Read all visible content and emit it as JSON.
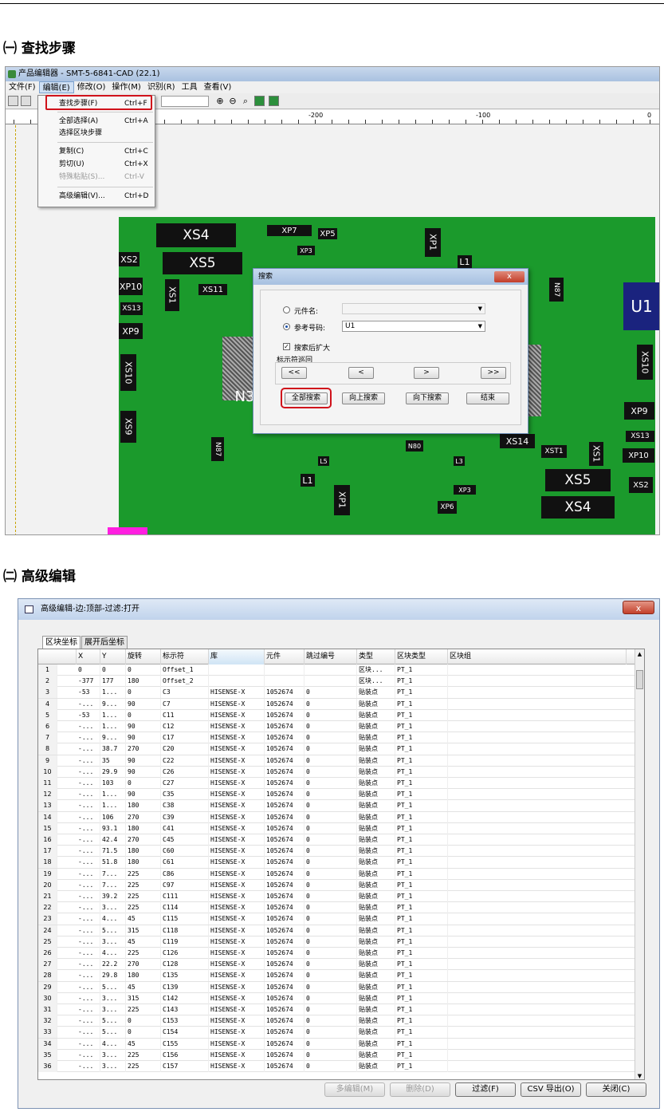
{
  "headings": {
    "h1": "㈠ 查找步骤",
    "h2": "㈡ 高级编辑"
  },
  "app1": {
    "title": "产品编辑器 - SMT-5-6841-CAD (22.1)",
    "menu": [
      "文件(F)",
      "编辑(E)",
      "修改(O)",
      "操作(M)",
      "识别(R)",
      "工具",
      "查看(V)"
    ],
    "ruler_labels": [
      "-200",
      "-100",
      "0"
    ],
    "dropdown": [
      {
        "label": "查找步骤(F)",
        "shortcut": "Ctrl+F"
      },
      {
        "label": "全部选择(A)",
        "shortcut": "Ctrl+A"
      },
      {
        "label": "选择区块步骤",
        "shortcut": ""
      },
      {
        "label": "复制(C)",
        "shortcut": "Ctrl+C"
      },
      {
        "label": "剪切(U)",
        "shortcut": "Ctrl+X"
      },
      {
        "label": "特殊粘贴(S)...",
        "shortcut": "Ctrl-V"
      },
      {
        "label": "高级编辑(V)...",
        "shortcut": "Ctrl+D"
      }
    ],
    "pcb_labels": {
      "xs4": "XS4",
      "xs5": "XS5",
      "xs2": "XS2",
      "xp10": "XP10",
      "xs13": "XS13",
      "xp9": "XP9",
      "xs10": "XS10",
      "xs9": "XS9",
      "xs1": "XS1",
      "xs11": "XS11",
      "xp7": "XP7",
      "xp5": "XP5",
      "xp3": "XP3",
      "xp1": "XP1",
      "l1": "L1",
      "n3": "N3",
      "u1": "U1",
      "xs14": "XS14",
      "xst1": "XST1",
      "xp6": "XP6",
      "xs2r": "XS2",
      "xp10r": "XP10",
      "xs13r": "XS13",
      "n80": "N80",
      "l5": "L5",
      "l3": "L3",
      "n87": "N87"
    },
    "dialog": {
      "title": "搜索",
      "close": "x",
      "opt_component": "元件名:",
      "opt_refdes": "参考号码:",
      "refdes_value": "U1",
      "expand_label": "搜索后扩大",
      "group_label": "标示符巡回",
      "nav": [
        "<<",
        "<",
        ">",
        ">>"
      ],
      "buttons": [
        "全部搜索",
        "向上搜索",
        "向下搜索",
        "结束"
      ]
    }
  },
  "app2": {
    "title": "高级编辑-边:顶部-过滤:打开",
    "close": "x",
    "tabs": [
      "区块坐标",
      "展开后坐标"
    ],
    "columns": [
      "",
      "X",
      "Y",
      "旋转",
      "标示符",
      "库",
      "元件",
      "跳过编号",
      "类型",
      "区块类型",
      "区块组"
    ],
    "rows": [
      [
        "1",
        "0",
        "0",
        "0",
        "Offset_1",
        "",
        "",
        "",
        "区块...",
        "PT_1"
      ],
      [
        "2",
        "-377",
        "177",
        "180",
        "Offset_2",
        "",
        "",
        "",
        "区块...",
        "PT_1"
      ],
      [
        "3",
        "-53",
        "1...",
        "0",
        "C3",
        "HISENSE-X",
        "1052674",
        "0",
        "贴装点",
        "PT_1"
      ],
      [
        "4",
        "-...",
        "9...",
        "90",
        "C7",
        "HISENSE-X",
        "1052674",
        "0",
        "贴装点",
        "PT_1"
      ],
      [
        "5",
        "-53",
        "1...",
        "0",
        "C11",
        "HISENSE-X",
        "1052674",
        "0",
        "贴装点",
        "PT_1"
      ],
      [
        "6",
        "-...",
        "1...",
        "90",
        "C12",
        "HISENSE-X",
        "1052674",
        "0",
        "贴装点",
        "PT_1"
      ],
      [
        "7",
        "-...",
        "9...",
        "90",
        "C17",
        "HISENSE-X",
        "1052674",
        "0",
        "贴装点",
        "PT_1"
      ],
      [
        "8",
        "-...",
        "38.7",
        "270",
        "C20",
        "HISENSE-X",
        "1052674",
        "0",
        "贴装点",
        "PT_1"
      ],
      [
        "9",
        "-...",
        "35",
        "90",
        "C22",
        "HISENSE-X",
        "1052674",
        "0",
        "贴装点",
        "PT_1"
      ],
      [
        "10",
        "-...",
        "29.9",
        "90",
        "C26",
        "HISENSE-X",
        "1052674",
        "0",
        "贴装点",
        "PT_1"
      ],
      [
        "11",
        "-...",
        "103",
        "0",
        "C27",
        "HISENSE-X",
        "1052674",
        "0",
        "贴装点",
        "PT_1"
      ],
      [
        "12",
        "-...",
        "1...",
        "90",
        "C35",
        "HISENSE-X",
        "1052674",
        "0",
        "贴装点",
        "PT_1"
      ],
      [
        "13",
        "-...",
        "1...",
        "180",
        "C38",
        "HISENSE-X",
        "1052674",
        "0",
        "贴装点",
        "PT_1"
      ],
      [
        "14",
        "-...",
        "106",
        "270",
        "C39",
        "HISENSE-X",
        "1052674",
        "0",
        "贴装点",
        "PT_1"
      ],
      [
        "15",
        "-...",
        "93.1",
        "180",
        "C41",
        "HISENSE-X",
        "1052674",
        "0",
        "贴装点",
        "PT_1"
      ],
      [
        "16",
        "-...",
        "42.4",
        "270",
        "C45",
        "HISENSE-X",
        "1052674",
        "0",
        "贴装点",
        "PT_1"
      ],
      [
        "17",
        "-...",
        "71.5",
        "180",
        "C60",
        "HISENSE-X",
        "1052674",
        "0",
        "贴装点",
        "PT_1"
      ],
      [
        "18",
        "-...",
        "51.8",
        "180",
        "C61",
        "HISENSE-X",
        "1052674",
        "0",
        "贴装点",
        "PT_1"
      ],
      [
        "19",
        "-...",
        "7...",
        "225",
        "C86",
        "HISENSE-X",
        "1052674",
        "0",
        "贴装点",
        "PT_1"
      ],
      [
        "20",
        "-...",
        "7...",
        "225",
        "C97",
        "HISENSE-X",
        "1052674",
        "0",
        "贴装点",
        "PT_1"
      ],
      [
        "21",
        "-...",
        "39.2",
        "225",
        "C111",
        "HISENSE-X",
        "1052674",
        "0",
        "贴装点",
        "PT_1"
      ],
      [
        "22",
        "-...",
        "3...",
        "225",
        "C114",
        "HISENSE-X",
        "1052674",
        "0",
        "贴装点",
        "PT_1"
      ],
      [
        "23",
        "-...",
        "4...",
        "45",
        "C115",
        "HISENSE-X",
        "1052674",
        "0",
        "贴装点",
        "PT_1"
      ],
      [
        "24",
        "-...",
        "5...",
        "315",
        "C118",
        "HISENSE-X",
        "1052674",
        "0",
        "贴装点",
        "PT_1"
      ],
      [
        "25",
        "-...",
        "3...",
        "45",
        "C119",
        "HISENSE-X",
        "1052674",
        "0",
        "贴装点",
        "PT_1"
      ],
      [
        "26",
        "-...",
        "4...",
        "225",
        "C126",
        "HISENSE-X",
        "1052674",
        "0",
        "贴装点",
        "PT_1"
      ],
      [
        "27",
        "-...",
        "22.2",
        "270",
        "C128",
        "HISENSE-X",
        "1052674",
        "0",
        "贴装点",
        "PT_1"
      ],
      [
        "28",
        "-...",
        "29.8",
        "180",
        "C135",
        "HISENSE-X",
        "1052674",
        "0",
        "贴装点",
        "PT_1"
      ],
      [
        "29",
        "-...",
        "5...",
        "45",
        "C139",
        "HISENSE-X",
        "1052674",
        "0",
        "贴装点",
        "PT_1"
      ],
      [
        "30",
        "-...",
        "3...",
        "315",
        "C142",
        "HISENSE-X",
        "1052674",
        "0",
        "贴装点",
        "PT_1"
      ],
      [
        "31",
        "-...",
        "3...",
        "225",
        "C143",
        "HISENSE-X",
        "1052674",
        "0",
        "贴装点",
        "PT_1"
      ],
      [
        "32",
        "-...",
        "5...",
        "0",
        "C153",
        "HISENSE-X",
        "1052674",
        "0",
        "贴装点",
        "PT_1"
      ],
      [
        "33",
        "-...",
        "5...",
        "0",
        "C154",
        "HISENSE-X",
        "1052674",
        "0",
        "贴装点",
        "PT_1"
      ],
      [
        "34",
        "-...",
        "4...",
        "45",
        "C155",
        "HISENSE-X",
        "1052674",
        "0",
        "贴装点",
        "PT_1"
      ],
      [
        "35",
        "-...",
        "3...",
        "225",
        "C156",
        "HISENSE-X",
        "1052674",
        "0",
        "贴装点",
        "PT_1"
      ],
      [
        "36",
        "-...",
        "3...",
        "225",
        "C157",
        "HISENSE-X",
        "1052674",
        "0",
        "贴装点",
        "PT_1"
      ]
    ],
    "buttons": {
      "multi": "多编辑(M)",
      "delete": "删除(D)",
      "filter": "过滤(F)",
      "csv": "CSV 导出(O)",
      "close": "关闭(C)"
    }
  },
  "colors": {
    "pcb": "#1b9a2c",
    "u1_blue": "#1a237e",
    "u1_pink": "#ff1fe0",
    "highlight_red": "#d0121b"
  }
}
